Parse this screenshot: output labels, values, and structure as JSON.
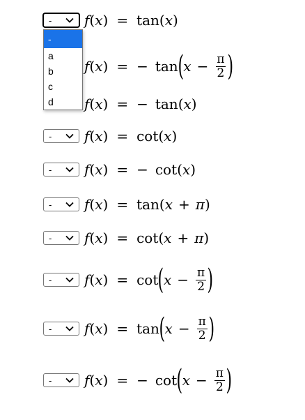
{
  "selects": {
    "selected_value": "-",
    "options": [
      "-",
      "a",
      "b",
      "c",
      "d"
    ]
  },
  "text": {
    "f": "f",
    "x": "x",
    "eq": "=",
    "neg": "−",
    "tan": "tan",
    "cot": "cot",
    "pi": "π",
    "two": "2",
    "plus": "+"
  },
  "rows": [
    {
      "expr": "f(x) = tan(x)"
    },
    {
      "expr": "f(x) = − tan(x − π/2)"
    },
    {
      "expr": "f(x) = − tan(x)"
    },
    {
      "expr": "f(x) = cot(x)"
    },
    {
      "expr": "f(x) = − cot(x)"
    },
    {
      "expr": "f(x) = tan(x + π)"
    },
    {
      "expr": "f(x) = cot(x + π)"
    },
    {
      "expr": "f(x) = cot(x − π/2)"
    },
    {
      "expr": "f(x) = tan(x − π/2)"
    },
    {
      "expr": "f(x) = − cot(x − π/2)"
    }
  ]
}
